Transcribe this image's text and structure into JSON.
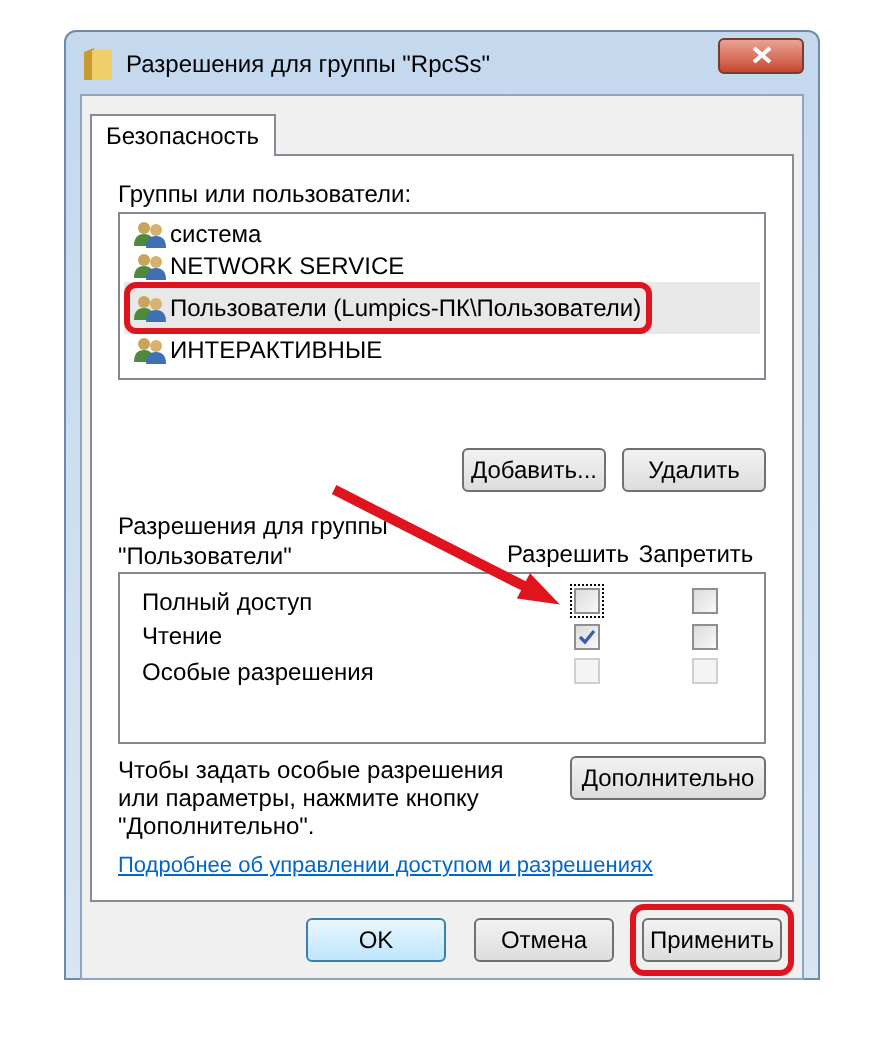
{
  "window": {
    "title": "Разрешения для группы \"RpcSs\""
  },
  "tabs": [
    {
      "label": "Безопасность",
      "selected": true
    }
  ],
  "groups": {
    "label": "Группы или пользователи:",
    "items": [
      {
        "name": "система",
        "selected": false,
        "highlighted": false
      },
      {
        "name": "NETWORK SERVICE",
        "selected": false,
        "highlighted": false
      },
      {
        "name": "Пользователи (Lumpics-ПК\\Пользователи)",
        "selected": true,
        "highlighted": true
      },
      {
        "name": "ИНТЕРАКТИВНЫЕ",
        "selected": false,
        "highlighted": false
      }
    ],
    "buttons": [
      "Добавить...",
      "Удалить"
    ]
  },
  "permissions": {
    "label": "Разрешения для группы \"Пользователи\"",
    "columns": [
      "Разрешить",
      "Запретить"
    ],
    "rows": [
      {
        "name": "Полный доступ",
        "allow": {
          "checked": false,
          "disabled": false,
          "focused": true
        },
        "deny": {
          "checked": false,
          "disabled": false,
          "focused": false
        }
      },
      {
        "name": "Чтение",
        "allow": {
          "checked": true,
          "disabled": false,
          "focused": false
        },
        "deny": {
          "checked": false,
          "disabled": false,
          "focused": false
        }
      },
      {
        "name": "Особые разрешения",
        "allow": {
          "checked": false,
          "disabled": true,
          "focused": false
        },
        "deny": {
          "checked": false,
          "disabled": true,
          "focused": false
        }
      }
    ]
  },
  "advanced": {
    "text": "Чтобы задать особые разрешения или параметры, нажмите кнопку \"Дополнительно\".",
    "button": "Дополнительно"
  },
  "link": "Подробнее об управлении доступом и разрешениях",
  "footer_buttons": [
    {
      "label": "OK",
      "default": true,
      "highlighted": false
    },
    {
      "label": "Отмена",
      "default": false,
      "highlighted": false
    },
    {
      "label": "Применить",
      "default": false,
      "highlighted": true
    }
  ]
}
